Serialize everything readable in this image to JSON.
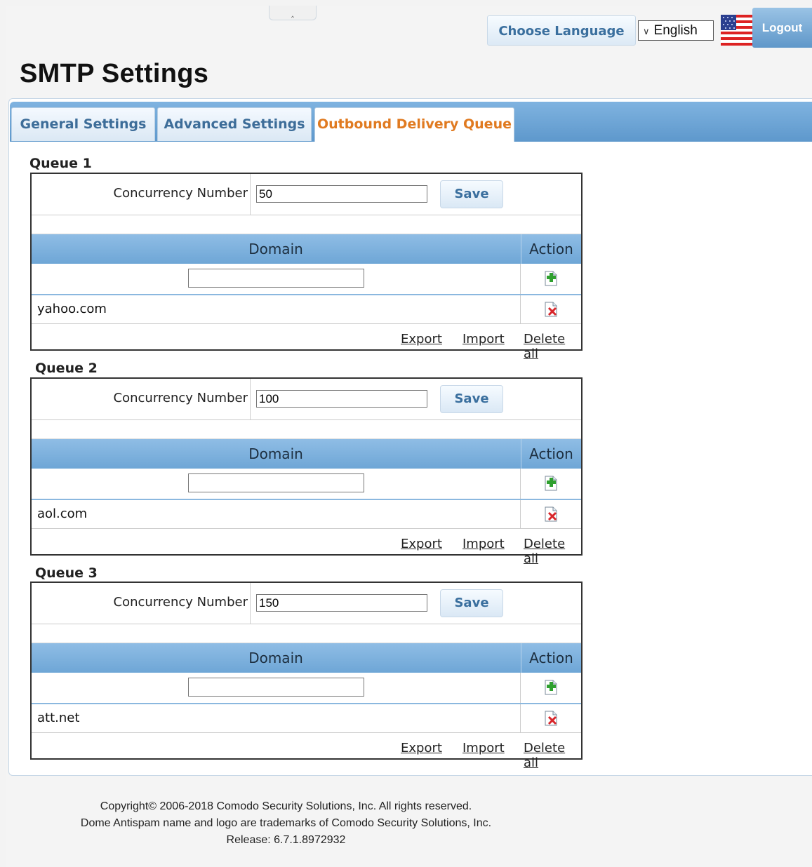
{
  "header": {
    "collapse_icon": "chevron-up-icon",
    "choose_language_label": "Choose Language",
    "language_selected": "English",
    "flag_icon": "us-flag-icon",
    "logout_label": "Logout"
  },
  "page": {
    "title": "SMTP Settings"
  },
  "tabs": [
    {
      "label": "General Settings",
      "active": false
    },
    {
      "label": "Advanced Settings",
      "active": false
    },
    {
      "label": "Outbound Delivery Queue",
      "active": true
    }
  ],
  "queues": [
    {
      "label": "Queue 1",
      "concurrency_label": "Concurrency Number",
      "concurrency_value": "50",
      "save_label": "Save",
      "domain_header": "Domain",
      "action_header": "Action",
      "domain_input_value": "",
      "items": [
        "yahoo.com"
      ],
      "export_label": "Export",
      "import_label": "Import",
      "delete_all_label": "Delete all"
    },
    {
      "label": "Queue 2",
      "concurrency_label": "Concurrency Number",
      "concurrency_value": "100",
      "save_label": "Save",
      "domain_header": "Domain",
      "action_header": "Action",
      "domain_input_value": "",
      "items": [
        "aol.com"
      ],
      "export_label": "Export",
      "import_label": "Import",
      "delete_all_label": "Delete all"
    },
    {
      "label": "Queue 3",
      "concurrency_label": "Concurrency Number",
      "concurrency_value": "150",
      "save_label": "Save",
      "domain_header": "Domain",
      "action_header": "Action",
      "domain_input_value": "",
      "items": [
        "att.net"
      ],
      "export_label": "Export",
      "import_label": "Import",
      "delete_all_label": "Delete all"
    }
  ],
  "icons": {
    "add": "add-icon",
    "delete": "delete-icon"
  },
  "colors": {
    "accent": "#e07a20",
    "tab_text": "#3d6d99",
    "header_blue": "#6ea6d6"
  },
  "footer": {
    "copyright": "Copyright© 2006-2018 Comodo Security Solutions, Inc. All rights reserved.",
    "trademark": "Dome Antispam name and logo are trademarks of Comodo Security Solutions, Inc.",
    "release": "Release: 6.7.1.8972932"
  }
}
